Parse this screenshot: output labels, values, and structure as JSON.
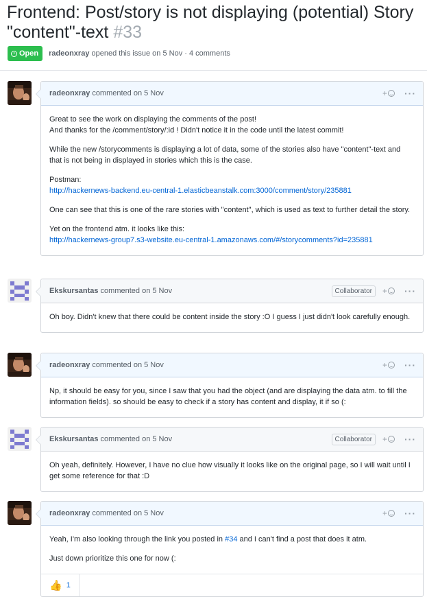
{
  "issue": {
    "title": "Frontend: Post/story is not displaying (potential) Story \"content\"-text",
    "number": "#33",
    "state": "Open",
    "author": "radeonxray",
    "meta_rest": "opened this issue on 5 Nov · 4 comments"
  },
  "comments": [
    {
      "author": "radeonxray",
      "date": "commented on 5 Nov",
      "lines": [
        "Great to see the work on displaying the comments of the post!",
        "And thanks for the /comment/story/:id ! Didn't notice it in the code until the latest commit!"
      ],
      "p2": "While the new /storycomments is displaying a lot of data, some of the stories also have \"content\"-text and that is not being in displayed in stories which this is the case.",
      "p3_label": "Postman:",
      "p3_link": "http://hackernews-backend.eu-central-1.elasticbeanstalk.com:3000/comment/story/235881",
      "p4": "One can see that this is one of the rare stories with \"content\", which is used as text to further detail the story.",
      "p5_label": "Yet on the frontend atm. it looks like this:",
      "p5_link": "http://hackernews-group7.s3-website.eu-central-1.amazonaws.com/#/storycomments?id=235881"
    },
    {
      "author": "Ekskursantas",
      "date": "commented on 5 Nov",
      "badge": "Collaborator",
      "p1": "Oh boy. Didn't knew that there could be content inside the story :O I guess I just didn't look carefully enough."
    },
    {
      "author": "radeonxray",
      "date": "commented on 5 Nov",
      "p1": "Np, it should be easy for you, since I saw that you had the object (and are displaying the data atm. to fill the information fields). so should be easy to check if a story has content and display, it if so (:"
    },
    {
      "author": "Ekskursantas",
      "date": "commented on 5 Nov",
      "badge": "Collaborator",
      "p1": "Oh yeah, definitely. However, I have no clue how visually it looks like on the original page, so I will wait until I get some reference for that :D"
    },
    {
      "author": "radeonxray",
      "date": "commented on 5 Nov",
      "p1_before": "Yeah, I'm also looking through the link you posted in ",
      "p1_link": "#34",
      "p1_after": " and I can't find a post that does it atm.",
      "p2": "Just down prioritize this one for now (:",
      "reaction_count": "1"
    }
  ],
  "ui": {
    "add_reaction": "+",
    "more": "···",
    "thumbs_up": "👍"
  },
  "colors": {
    "open_green": "#2cbe4e",
    "link_blue": "#0366d6",
    "header_blue": "#f1f8ff",
    "border": "#d1d5da"
  }
}
